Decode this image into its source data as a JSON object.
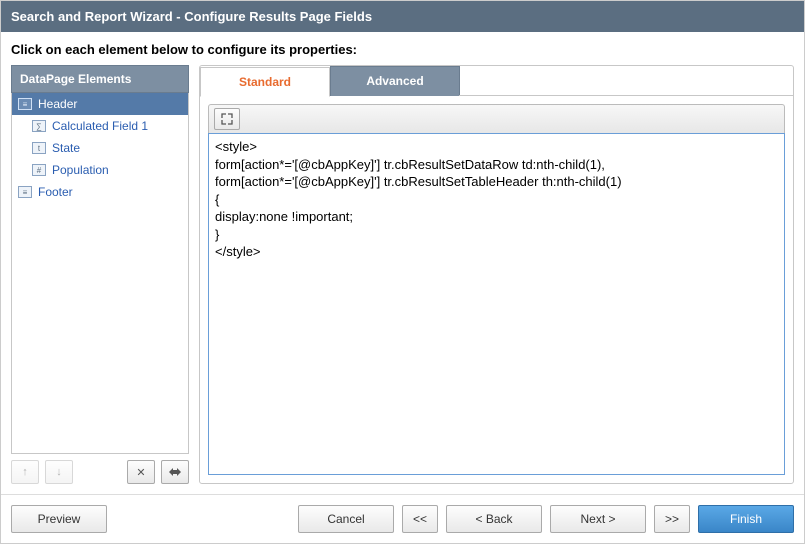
{
  "window": {
    "title": "Search and Report Wizard - Configure Results Page Fields"
  },
  "instruction": "Click on each element below to configure its properties:",
  "sidebar": {
    "header": "DataPage Elements",
    "items": [
      {
        "label": "Header",
        "type": "section",
        "selected": true,
        "icon": "header"
      },
      {
        "label": "Calculated Field 1",
        "type": "child",
        "selected": false,
        "icon": "calc"
      },
      {
        "label": "State",
        "type": "child",
        "selected": false,
        "icon": "text"
      },
      {
        "label": "Population",
        "type": "child",
        "selected": false,
        "icon": "number"
      },
      {
        "label": "Footer",
        "type": "section",
        "selected": false,
        "icon": "footer"
      }
    ]
  },
  "left_toolbar": {
    "up": "↑",
    "down": "↓",
    "delete": "✕",
    "insert": "⤢"
  },
  "tabs": [
    {
      "label": "Standard",
      "active": true
    },
    {
      "label": "Advanced",
      "active": false
    }
  ],
  "editor": {
    "content": "<style>\nform[action*='[@cbAppKey]'] tr.cbResultSetDataRow td:nth-child(1),\nform[action*='[@cbAppKey]'] tr.cbResultSetTableHeader th:nth-child(1)\n{\ndisplay:none !important;\n}\n</style>"
  },
  "footer": {
    "preview": "Preview",
    "cancel": "Cancel",
    "first": "<<",
    "back": "< Back",
    "next": "Next >",
    "last": ">>",
    "finish": "Finish"
  }
}
